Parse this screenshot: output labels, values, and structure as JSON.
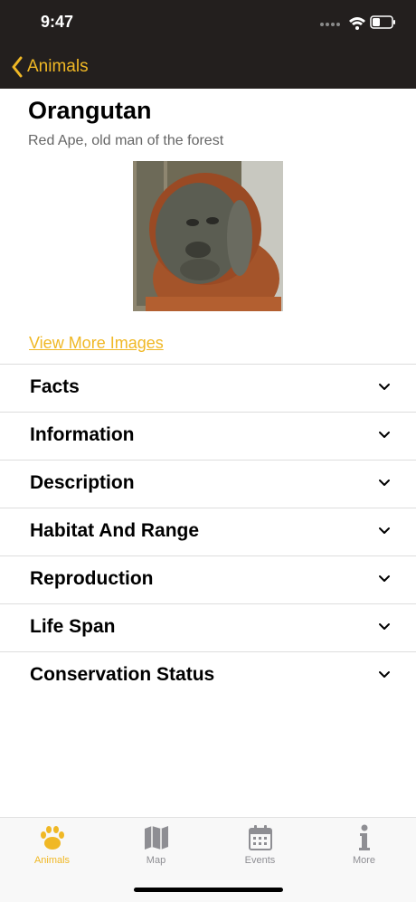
{
  "status_bar": {
    "time": "9:47"
  },
  "nav": {
    "back_label": "Animals"
  },
  "animal": {
    "name": "Orangutan",
    "subtitle": "Red Ape, old man of the forest",
    "more_images_label": "View More Images"
  },
  "sections": [
    {
      "label": "Facts"
    },
    {
      "label": "Information"
    },
    {
      "label": "Description"
    },
    {
      "label": "Habitat And Range"
    },
    {
      "label": "Reproduction"
    },
    {
      "label": "Life Span"
    },
    {
      "label": "Conservation Status"
    }
  ],
  "tabs": [
    {
      "label": "Animals",
      "icon": "paw-icon",
      "active": true
    },
    {
      "label": "Map",
      "icon": "map-icon",
      "active": false
    },
    {
      "label": "Events",
      "icon": "calendar-icon",
      "active": false
    },
    {
      "label": "More",
      "icon": "info-icon",
      "active": false
    }
  ],
  "colors": {
    "accent": "#f0b825",
    "bar_bg": "#231f1e",
    "inactive_tab": "#8e8e93"
  }
}
